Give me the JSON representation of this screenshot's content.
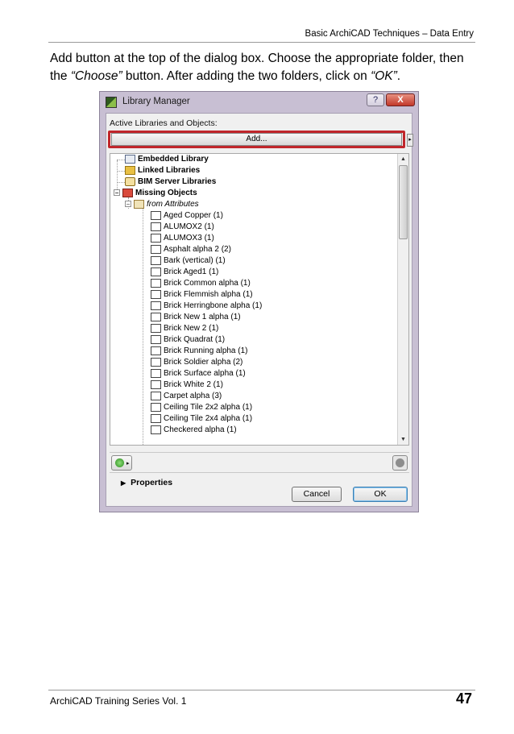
{
  "header": {
    "title": "Basic ArchiCAD Techniques – Data Entry"
  },
  "instruction": {
    "part1": "Add button at the top of the dialog box. Choose the appropriate folder, then the ",
    "choose": "“Choose”",
    "part2": " button. After adding the two folders, click on ",
    "ok": "“OK”",
    "part3": "."
  },
  "dialog": {
    "title": "Library Manager",
    "help_label": "?",
    "close_label": "X",
    "section_label": "Active Libraries and Objects:",
    "add_label": "Add...",
    "add_arrow": "▸",
    "tree": {
      "embedded": "Embedded Library",
      "linked": "Linked Libraries",
      "bim": "BIM Server Libraries",
      "missing": "Missing Objects",
      "from_attributes": "from Attributes",
      "objects": [
        "Aged Copper (1)",
        "ALUMOX2 (1)",
        "ALUMOX3 (1)",
        "Asphalt alpha 2 (2)",
        "Bark (vertical) (1)",
        "Brick Aged1 (1)",
        "Brick Common alpha (1)",
        "Brick Flemmish alpha (1)",
        "Brick Herringbone alpha (1)",
        "Brick New 1 alpha (1)",
        "Brick New 2 (1)",
        "Brick Quadrat (1)",
        "Brick Running alpha (1)",
        "Brick Soldier alpha (2)",
        "Brick Surface alpha (1)",
        "Brick White 2 (1)",
        "Carpet alpha (3)",
        "Ceiling Tile 2x2 alpha (1)",
        "Ceiling Tile 2x4 alpha (1)",
        "Checkered alpha (1)"
      ]
    },
    "properties_label": "Properties",
    "cancel_label": "Cancel",
    "ok_label": "OK",
    "colors": {
      "highlight": "#c0262b",
      "frame": "#c8bfd3"
    }
  },
  "footer": {
    "series": "ArchiCAD Training Series Vol. 1",
    "page": "47"
  }
}
